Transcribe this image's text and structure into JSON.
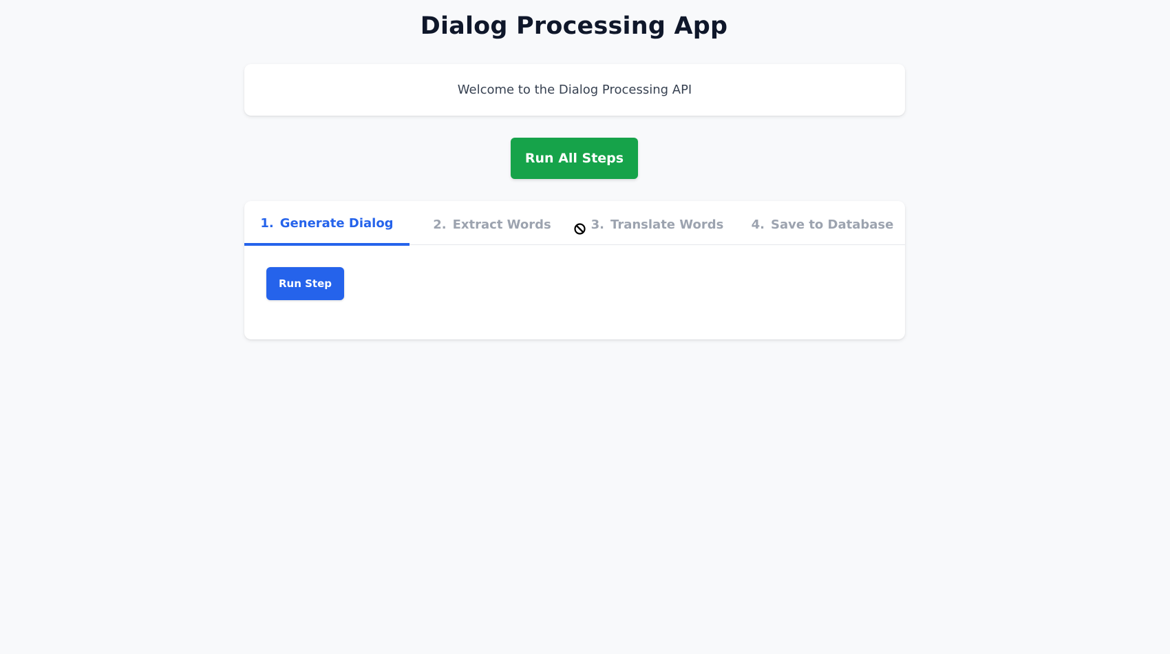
{
  "app": {
    "title": "Dialog Processing App"
  },
  "welcome": {
    "message": "Welcome to the Dialog Processing API"
  },
  "actions": {
    "run_all_label": "Run All Steps",
    "run_step_label": "Run Step"
  },
  "tabs": [
    {
      "number": "1.",
      "label": "Generate Dialog",
      "active": true
    },
    {
      "number": "2.",
      "label": "Extract Words",
      "active": false
    },
    {
      "number": "3.",
      "label": "Translate Words",
      "active": false
    },
    {
      "number": "4.",
      "label": "Save to Database",
      "active": false
    }
  ],
  "cursor": {
    "icon": "not-allowed-cursor-icon"
  },
  "colors": {
    "accent": "#2563eb",
    "run_all": "#16a34a",
    "background": "#f8f9fb",
    "inactive_tab": "#9ca3af"
  }
}
